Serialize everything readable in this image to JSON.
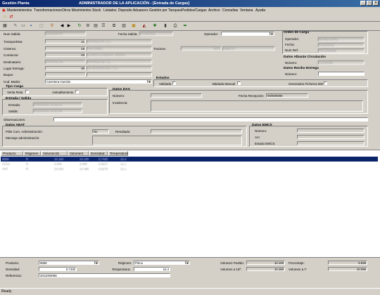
{
  "window": {
    "title": "Gestión Planta",
    "subtitle": "ADMINISTRADOR DE LA APLICACIÓN - [Entrada de Cargas]"
  },
  "menu": [
    "Mantenimientos",
    "Transformaciones",
    "Otros Movimientos",
    "Stock",
    "Listados",
    "Deposito Aduanero",
    "Gestión por Tanques",
    "Pedidos/Cargas",
    "Archivo",
    "Consultas",
    "Ventana",
    "Ayuda"
  ],
  "form": {
    "num_salida_label": "Num Salida:",
    "num_salida": "2011000767",
    "fecha_salida_label": "Fecha Salida:",
    "fecha_salida": "01/03/2011",
    "operador_label": "Operador:",
    "transportista_label": "Transportista:",
    "transportista_code": "11",
    "transportista_name": "PETROCAR, S.L.",
    "cisterna_label": "Cisterna:",
    "cisterna_code": "19",
    "cisterna_name": "R0210BBC",
    "tractora_label": "Tractora:",
    "tractora_plate": "4573",
    "tractora_name": "BBBC27",
    "conductor_label": "Conductor:",
    "conductor_code": "23",
    "conductor_name": "GARCIA ZAMORA, PEDRO",
    "destinatario_label": "Destinatario:",
    "destinatario_code": "PETROCAR",
    "destinatario_name": "PETROCAR, S.L.",
    "lugar_entrega_label": "Lugar Entrega:",
    "lugar_entrega_code": "39",
    "lugar_entrega_name": "JH BARCELONA, S.A.",
    "buque_label": "Buque:",
    "cod_medio_label": "Cod. Medio:",
    "cod_medio": "Carretera-Camión"
  },
  "orden_carga": {
    "title": "Orden de Carga",
    "operador_label": "Operador:",
    "operador": "BARBASTRO",
    "fecha_label": "Fecha:",
    "fecha": "01/03/2011",
    "num_ref_label": "Num Ref:",
    "num_ref": "2011000398"
  },
  "albaran": {
    "title": "Datos Albarán Circulación",
    "numero_label": "Número:",
    "numero": "11000199"
  },
  "recibo": {
    "title": "Datos Recibo Entrega",
    "numero_label": "Número:"
  },
  "estados": {
    "title": "Estados",
    "validada": "Validada",
    "validada_manual": "Validada Manual",
    "generados": "Generados Ficheros IEE"
  },
  "tipo_carga": {
    "title": "Tipo Carga",
    "venta": "Venta Ruta",
    "avituallamiento": "Avituallamiento"
  },
  "daa": {
    "title": "Datos DAA",
    "numero_label": "Número:",
    "fecha_recepcion_label": "Fecha Recepción:",
    "fecha_recepcion": "00/00/0000",
    "incidencia_label": "Incidencia:"
  },
  "entrada_salida": {
    "title": "Entrada / Salida",
    "entrada_label": "Entrada:",
    "entrada": "01/03/2011 10:08:18",
    "salida_label": "Salida:",
    "salida": "01/03/2011 10:22:09"
  },
  "observaciones_label": "Observaciones:",
  "aeat": {
    "title": "Datos AEAT",
    "pdte_label": "Pdte Com. Administración:",
    "pdte": "No",
    "resultado_label": "Resultado:",
    "mensaje_label": "Mensaje administración:"
  },
  "emcs": {
    "title": "Datos EMCS",
    "numero_label": "Número:",
    "arc_label": "Arc:",
    "estado_label": "Estado EMCS:"
  },
  "grid": {
    "headers": [
      "Producto",
      "Régimen",
      "Volumen15",
      "Volument",
      "Densidad",
      "Temperatura"
    ],
    "rows": [
      [
        "9589",
        "R",
        "10.160",
        "10.100",
        "0,7430",
        "10,4"
      ],
      [
        "AFSA",
        "R",
        "3.006",
        "3.000",
        "0,8017",
        "12,1"
      ],
      [
        "ANT",
        "R",
        "10.026",
        "10.486",
        "0,6275",
        "12,1"
      ]
    ]
  },
  "bottom": {
    "producto_label": "Producto:",
    "producto": "9589",
    "regimen_label": "Régimen:",
    "regimen": "Pleno",
    "densidad_label": "Densidad:",
    "densidad": "0,7430",
    "temperatura_label": "Temperatura:",
    "temperatura": "10,4",
    "referencia_label": "Referencia:",
    "referencia": "2011003098",
    "vol_pedido_label": "Volumen Pedido:",
    "vol_pedido": "10.100",
    "vol15_label": "Volumen a 15º:",
    "vol15": "10.160",
    "porcentaje_label": "Porcentaje:",
    "porcentaje": "6,939",
    "volt_label": "Volumen a T:",
    "volt": "10.096"
  },
  "status": "Ready"
}
